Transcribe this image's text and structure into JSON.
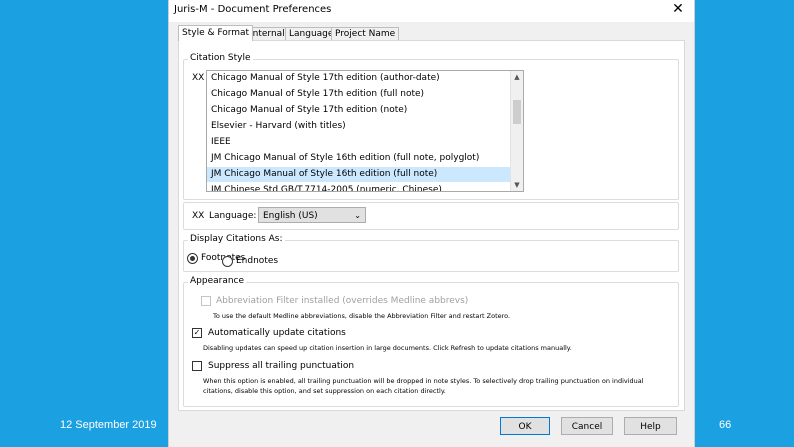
{
  "window": {
    "title": "Juris-M - Document Preferences",
    "close_label": "✕"
  },
  "tabs": [
    {
      "label": "Style & Format",
      "active": true
    },
    {
      "label": "Internal",
      "active": false
    },
    {
      "label": "Languages",
      "active": false
    },
    {
      "label": "Project Name",
      "active": false
    }
  ],
  "citation_style": {
    "legend": "Citation Style",
    "prefix": "XX",
    "items": [
      {
        "label": "Chicago Manual of Style 17th edition (author-date)",
        "selected": false
      },
      {
        "label": "Chicago Manual of Style 17th edition (full note)",
        "selected": false
      },
      {
        "label": "Chicago Manual of Style 17th edition (note)",
        "selected": false
      },
      {
        "label": "Elsevier - Harvard (with titles)",
        "selected": false
      },
      {
        "label": "IEEE",
        "selected": false
      },
      {
        "label": "JM Chicago Manual of Style 16th edition (full note, polyglot)",
        "selected": false
      },
      {
        "label": "JM Chicago Manual of Style 16th edition (full note)",
        "selected": true
      },
      {
        "label": "JM Chinese Std GB/T.7714-2005 (numeric, Chinese)",
        "selected": false
      }
    ],
    "scroll_up": "▲",
    "scroll_down": "▼"
  },
  "language": {
    "prefix": "XX",
    "label": "Language:",
    "value": "English (US)",
    "arrow": "⌄"
  },
  "display_citations": {
    "legend": "Display Citations As:",
    "footnotes_label": "Footnotes",
    "endnotes_label": "Endnotes",
    "selected": "Footnotes"
  },
  "appearance": {
    "legend": "Appearance",
    "abbrev_label": "Abbreviation Filter installed (overrides Medline abbrevs)",
    "abbrev_checked": false,
    "abbrev_note": "To use the default Medline abbreviations, disable the Abbreviation Filter and restart Zotero.",
    "auto_update_label": "Automatically update citations",
    "auto_update_checked": true,
    "auto_update_check_glyph": "✓",
    "auto_update_note": "Disabling updates can speed up citation insertion in large documents. Click Refresh to update citations manually.",
    "suppress_label": "Suppress all trailing punctuation",
    "suppress_checked": false,
    "suppress_note_1": "When this option is enabled, all trailing punctuation will be dropped in note styles. To selectively drop trailing punctuation on individual",
    "suppress_note_2": "citations, disable this option, and set suppression on each citation directly."
  },
  "buttons": {
    "ok": "OK",
    "cancel": "Cancel",
    "help": "Help"
  },
  "slide": {
    "date": "12 September 2019",
    "page_number": "66"
  },
  "colors": {
    "slide_background": "#1ba1e2",
    "selection": "#cce8ff",
    "default_button_border": "#0078d7"
  }
}
